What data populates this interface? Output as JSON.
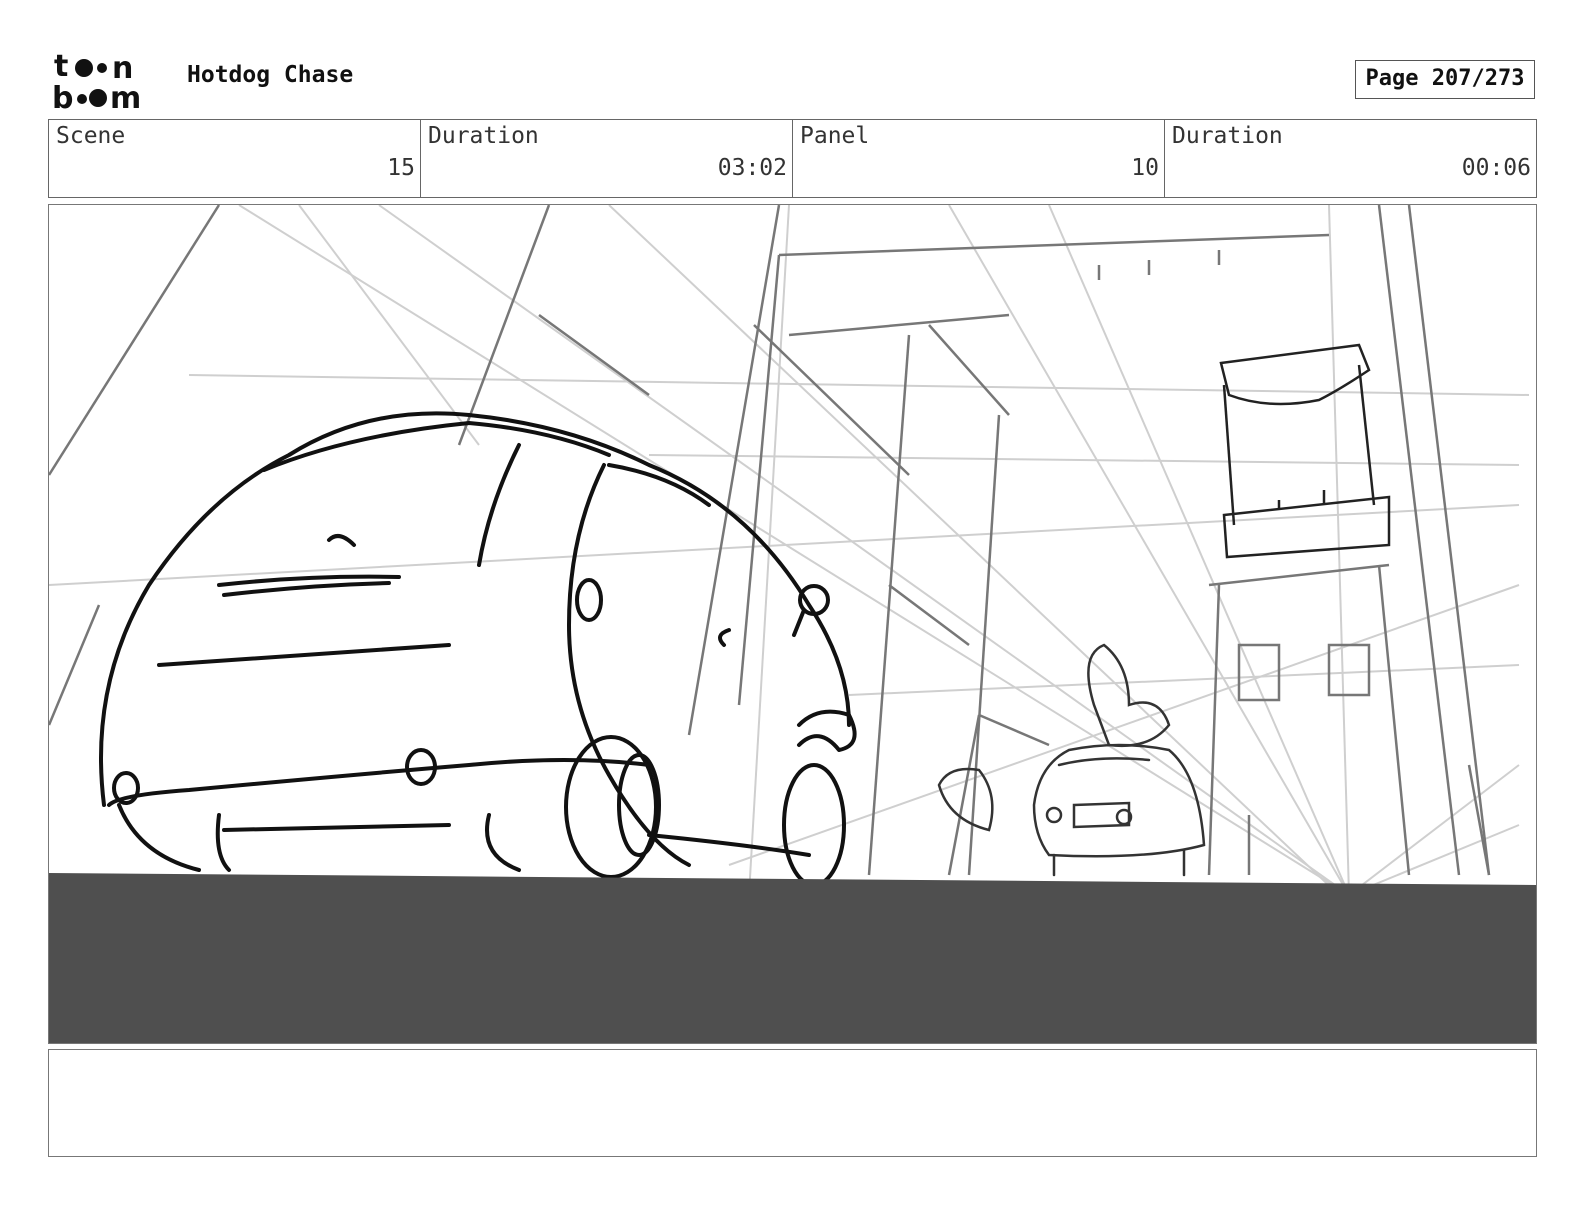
{
  "header": {
    "logo_text": "toon boom",
    "project_title": "Hotdog Chase",
    "page_label": "Page 207/273"
  },
  "info": {
    "scene_label": "Scene",
    "scene_value": "15",
    "scene_duration_label": "Duration",
    "scene_duration_value": "03:02",
    "panel_label": "Panel",
    "panel_value": "10",
    "panel_duration_label": "Duration",
    "panel_duration_value": "00:06"
  },
  "panel": {
    "description": "",
    "icons": [
      "storyboard-sketch-image"
    ]
  },
  "notes": {
    "text": ""
  }
}
